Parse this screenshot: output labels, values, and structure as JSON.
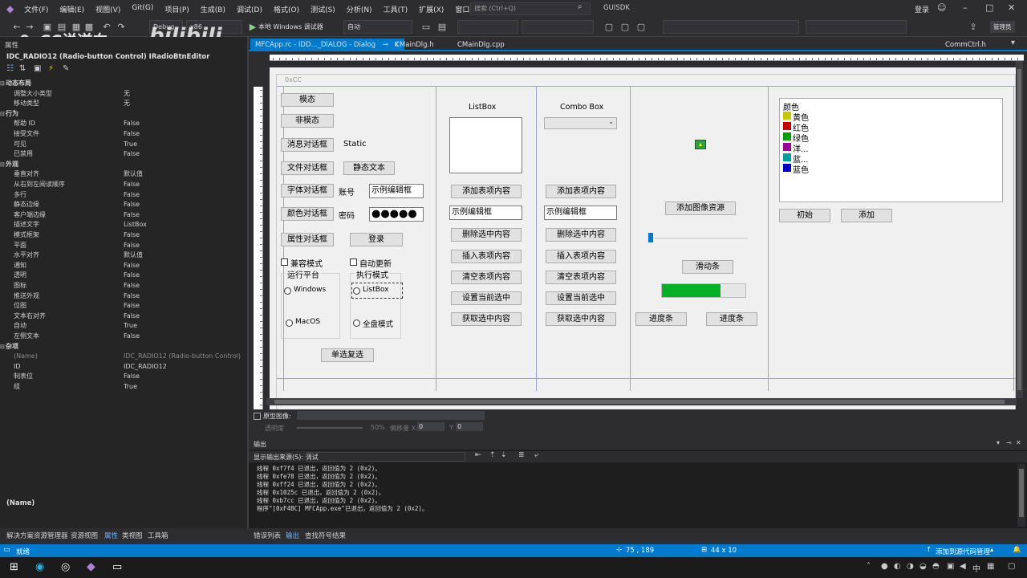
{
  "menu": [
    "文件(F)",
    "编辑(E)",
    "视图(V)",
    "Git(G)",
    "项目(P)",
    "生成(B)",
    "调试(D)",
    "格式(O)",
    "测试(S)",
    "分析(N)",
    "工具(T)",
    "扩展(X)",
    "窗口(W)",
    "帮助(H)"
  ],
  "search_placeholder": "搜索 (Ctrl+Q)",
  "solution_name": "GUISDK",
  "login": "登录",
  "admin_badge": "管理员",
  "toolbar": {
    "config": "Debug",
    "platform": "x86",
    "run": "本地 Windows 调试器",
    "auto": "自动"
  },
  "watermark": {
    "brand": "0xCC说逆向",
    "site": "bilibili"
  },
  "props": {
    "title": "属性",
    "object": "IDC_RADIO12 (Radio-button Control)  IRadioBtnEditor",
    "rows": [
      {
        "k": "动态布局",
        "v": "",
        "cat": true
      },
      {
        "k": "调整大小类型",
        "v": "无"
      },
      {
        "k": "移动类型",
        "v": "无"
      },
      {
        "k": "行为",
        "v": "",
        "cat": true
      },
      {
        "k": "帮助 ID",
        "v": "False"
      },
      {
        "k": "接受文件",
        "v": "False"
      },
      {
        "k": "可见",
        "v": "True"
      },
      {
        "k": "已禁用",
        "v": "False"
      },
      {
        "k": "外观",
        "v": "",
        "cat": true
      },
      {
        "k": "垂直对齐",
        "v": "默认值"
      },
      {
        "k": "从右到左阅读顺序",
        "v": "False"
      },
      {
        "k": "多行",
        "v": "False"
      },
      {
        "k": "静态边缘",
        "v": "False"
      },
      {
        "k": "客户端边缘",
        "v": "False"
      },
      {
        "k": "描述文字",
        "v": "ListBox"
      },
      {
        "k": "模式框架",
        "v": "False"
      },
      {
        "k": "平面",
        "v": "False"
      },
      {
        "k": "水平对齐",
        "v": "默认值"
      },
      {
        "k": "通知",
        "v": "False"
      },
      {
        "k": "透明",
        "v": "False"
      },
      {
        "k": "图标",
        "v": "False"
      },
      {
        "k": "推送外观",
        "v": "False"
      },
      {
        "k": "位图",
        "v": "False"
      },
      {
        "k": "文本右对齐",
        "v": "False"
      },
      {
        "k": "自动",
        "v": "True"
      },
      {
        "k": "左侧文本",
        "v": "False"
      },
      {
        "k": "杂项",
        "v": "",
        "cat": true
      },
      {
        "k": "(Name)",
        "v": "IDC_RADIO12 (Radio-button Control)",
        "dim": true
      },
      {
        "k": "ID",
        "v": "IDC_RADIO12"
      },
      {
        "k": "制表位",
        "v": "False"
      },
      {
        "k": "组",
        "v": "True"
      }
    ],
    "desc_title": "(Name)"
  },
  "tabs": [
    "MFCApp.rc - IDD..._DIALOG - Dialog",
    "CMainDlg.h",
    "CMainDlg.cpp",
    "CommCtrl.h"
  ],
  "dialog": {
    "title": "0xCC",
    "buttons_left": [
      "模态",
      "非模态",
      "消息对话框",
      "文件对话框",
      "字体对话框",
      "颜色对话框",
      "属性对话框"
    ],
    "static_label": "Static",
    "static_text_btn": "静态文本",
    "account_label": "账号",
    "password_label": "密码",
    "edit_sample": "示例编辑框",
    "password_value": "●●●●●",
    "login_btn": "登录",
    "compat_mode": "兼容模式",
    "auto_update": "自动更新",
    "run_platform": "运行平台",
    "exec_mode": "执行模式",
    "radio_windows": "Windows",
    "radio_macos": "MacOS",
    "radio_listbox": "ListBox",
    "radio_fulldisk": "全盘模式",
    "radio_check_btn": "单选复选",
    "listbox_title": "ListBox",
    "combobox_title": "Combo Box",
    "list_ops": [
      "添加表项内容",
      "示例编辑框",
      "删除选中内容",
      "插入表项内容",
      "清空表项内容",
      "设置当前选中",
      "获取选中内容"
    ],
    "add_image_btn": "添加图像资源",
    "slider_btn": "滑动条",
    "progress_btn1": "进度条",
    "progress_btn2": "进度条",
    "progress_value": 0.7,
    "color_list_header": "颜色",
    "color_items": [
      {
        "label": "黄色",
        "color": "#c8c800"
      },
      {
        "label": "红色",
        "color": "#c80000"
      },
      {
        "label": "绿色",
        "color": "#00a000"
      },
      {
        "label": "洋...",
        "color": "#a000a0"
      },
      {
        "label": "蓝...",
        "color": "#00a0a0"
      },
      {
        "label": "蓝色",
        "color": "#0000c8"
      }
    ],
    "init_btn": "初始",
    "add_btn": "添加"
  },
  "proto": {
    "label": "原型图像:",
    "opacity": "透明度",
    "percent": "50%",
    "offset_x": "偏移量 X:",
    "x_val": "0",
    "y_label": "Y:",
    "y_val": "0"
  },
  "output": {
    "title": "输出",
    "source_label": "显示输出来源(S): 调试",
    "lines": [
      "线程 0xf7f4 已退出，返回值为 2 (0x2)。",
      "线程 0xfe78 已退出，返回值为 2 (0x2)。",
      "线程 0xff24 已退出，返回值为 2 (0x2)。",
      "线程 0x1025c 已退出，返回值为 2 (0x2)。",
      "线程 0xb7cc 已退出，返回值为 2 (0x2)。",
      "程序\"[0xF4BC] MFCApp.exe\"已退出，返回值为 2 (0x2)。"
    ]
  },
  "bottom_left_tabs": [
    "解决方案资源管理器",
    "资源视图",
    "属性",
    "类视图",
    "工具箱"
  ],
  "bottom_out_tabs": [
    "错误列表",
    "输出",
    "查找符号结果"
  ],
  "status": {
    "ready": "就绪",
    "pos": "75 , 189",
    "size": "44 x 10",
    "source_control": "添加到源代码管理"
  }
}
